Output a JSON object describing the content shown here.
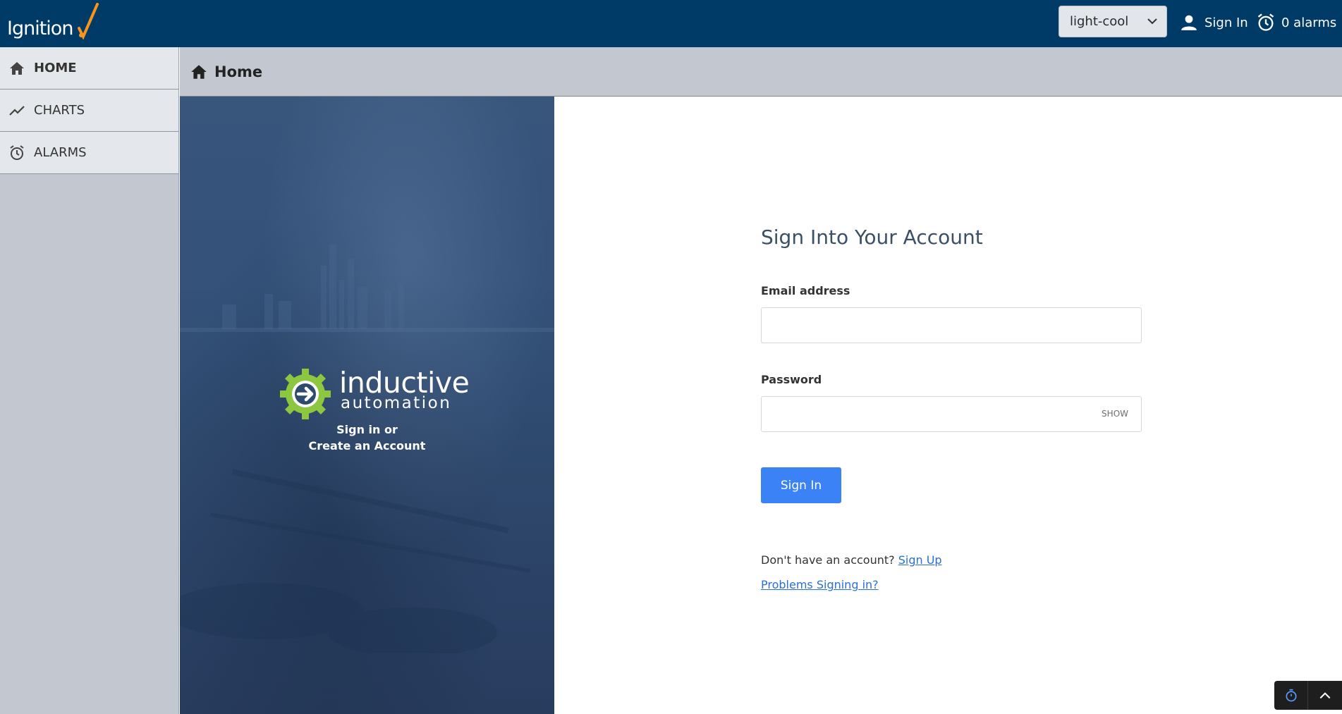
{
  "app": {
    "logo_text": "Ignition"
  },
  "topbar": {
    "theme_value": "light-cool",
    "signin_label": "Sign In",
    "alarms_label": "0 alarms"
  },
  "sidebar": {
    "items": [
      {
        "label": "HOME",
        "icon": "home-icon",
        "active": true
      },
      {
        "label": "CHARTS",
        "icon": "trend-chart-icon",
        "active": false
      },
      {
        "label": "ALARMS",
        "icon": "alarm-clock-icon",
        "active": false
      }
    ]
  },
  "breadcrumb": {
    "title": "Home",
    "icon": "home-icon"
  },
  "hero": {
    "brand_line1": "inductive",
    "brand_line2": "automation",
    "cta_line1": "Sign in or",
    "cta_line2": "Create an Account"
  },
  "login": {
    "title": "Sign Into Your Account",
    "email_label": "Email address",
    "email_value": "",
    "password_label": "Password",
    "password_value": "",
    "show_label": "SHOW",
    "submit_label": "Sign In",
    "no_account_text": "Don't have an account?",
    "signup_label": "Sign Up",
    "problems_label": "Problems Signing in?"
  },
  "colors": {
    "topbar": "#003a66",
    "accent_blue": "#3b82f6",
    "link": "#2a6fd6",
    "logo_check": "#f7941d",
    "gear_green": "#8dc63f"
  }
}
